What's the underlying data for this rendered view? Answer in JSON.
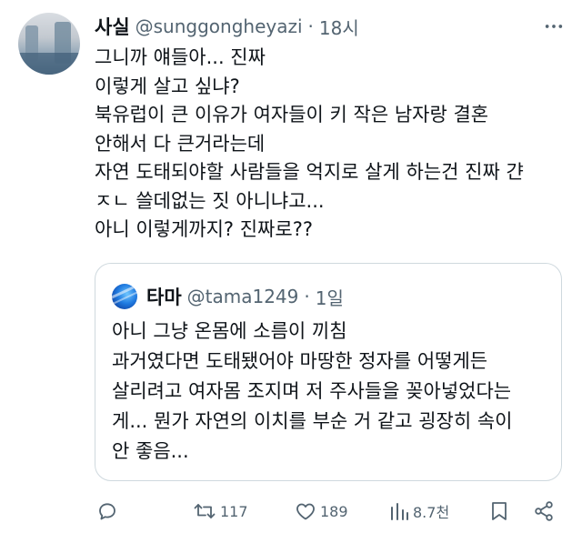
{
  "tweet": {
    "display_name": "사실",
    "handle": "@sunggongheyazi",
    "separator": "·",
    "time": "18시",
    "lines": [
      "그니까 얘들아... 진짜",
      "이렇게 살고 싶냐?",
      "북유럽이 큰 이유가 여자들이 키 작은 남자랑 결혼",
      "안해서 다 큰거라는데",
      "자연 도태되야할 사람들을 억지로 살게 하는건 진짜 갼",
      "ㅈㄴ 쓸데없는 짓 아니냐고...",
      "아니 이렇게까지? 진짜로??"
    ]
  },
  "quote": {
    "display_name": "타마",
    "handle": "@tama1249",
    "separator": "·",
    "time": "1일",
    "lines": [
      "아니 그냥 온몸에 소름이 끼침",
      "과거였다면 도태됐어야 마땅한 정자를 어떻게든",
      "살리려고 여자몸 조지며 저 주사들을 꽂아넣었다는",
      "게... 뭔가 자연의 이치를 부순 거 같고 굉장히 속이",
      "안 좋음..."
    ]
  },
  "actions": {
    "reply_icon": "reply-icon",
    "retweet_icon": "retweet-icon",
    "retweet_count": "117",
    "like_icon": "heart-icon",
    "like_count": "189",
    "views_icon": "bar-chart-icon",
    "views_count": "8.7천",
    "bookmark_icon": "bookmark-icon",
    "share_icon": "share-icon"
  },
  "colors": {
    "text": "#0f1419",
    "secondary": "#536471",
    "border": "#cfd9de"
  }
}
